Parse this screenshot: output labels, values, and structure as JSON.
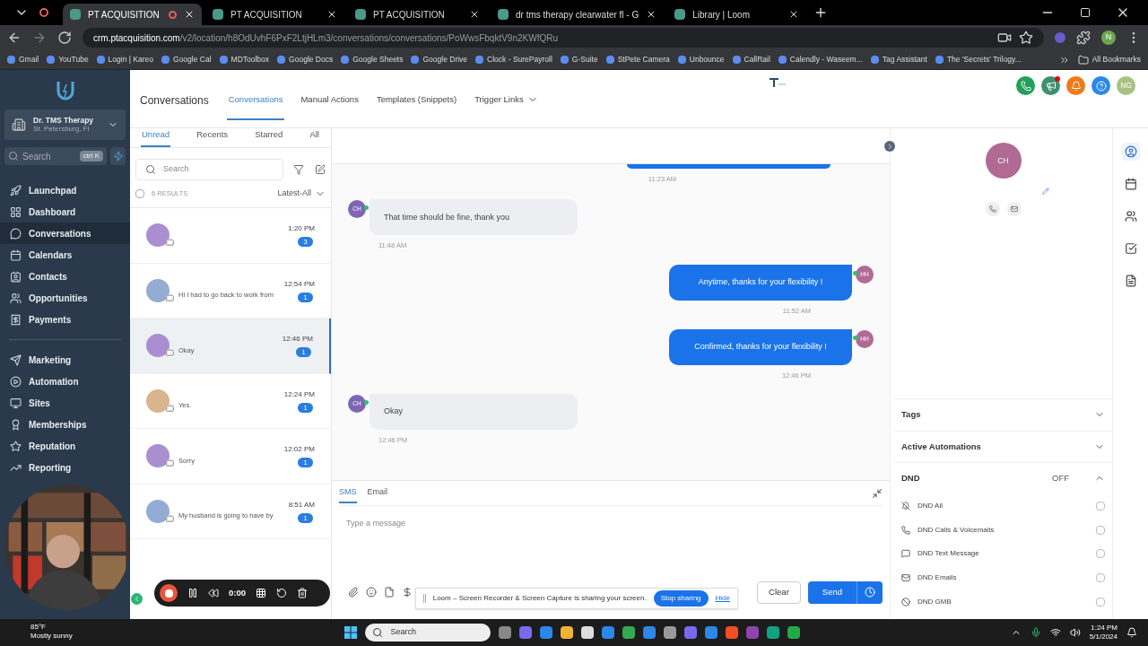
{
  "browser": {
    "tabs": [
      {
        "title": "PT ACQUISITION",
        "selected": true,
        "recording": true
      },
      {
        "title": "PT ACQUISITION",
        "selected": false,
        "recording": false
      },
      {
        "title": "PT ACQUISITION",
        "selected": false,
        "recording": false
      },
      {
        "title": "dr tms therapy clearwater fl - G",
        "selected": false,
        "recording": false
      },
      {
        "title": "Library | Loom",
        "selected": false,
        "recording": false
      }
    ],
    "url_host": "crm.ptacquisition.com",
    "url_path": "/v2/location/h8OdUvhF6PxF2LtjHLm3/conversations/conversations/PoWwsFbqktV9n2KWfQRu",
    "bookmarks": [
      "Gmail",
      "YouTube",
      "Login | Kareo",
      "Google Cal",
      "MDToolbox",
      "Google Docs",
      "Google Sheets",
      "Google Drive",
      "Clock - SurePayroll",
      "G-Suite",
      "StPete Camera",
      "Unbounce",
      "CallRail",
      "Calendly - Waseem...",
      "Tag Assistant",
      "The 'Secrets' Trilogy..."
    ],
    "all_bookmarks": "All Bookmarks",
    "profile": "N"
  },
  "account": {
    "name": "Dr. TMS Therapy",
    "location": "St. Petersburg, Fl"
  },
  "sidebar_search": {
    "placeholder": "Search",
    "shortcut": "ctrl K"
  },
  "nav_groups": [
    [
      {
        "label": "Launchpad",
        "selected": false
      },
      {
        "label": "Dashboard",
        "selected": false
      },
      {
        "label": "Conversations",
        "selected": true
      },
      {
        "label": "Calendars",
        "selected": false
      },
      {
        "label": "Contacts",
        "selected": false
      },
      {
        "label": "Opportunities",
        "selected": false
      },
      {
        "label": "Payments",
        "selected": false
      }
    ],
    [
      {
        "label": "Marketing",
        "selected": false
      },
      {
        "label": "Automation",
        "selected": false
      },
      {
        "label": "Sites",
        "selected": false
      },
      {
        "label": "Memberships",
        "selected": false
      },
      {
        "label": "Reputation",
        "selected": false
      },
      {
        "label": "Reporting",
        "selected": false
      }
    ]
  ],
  "header": {
    "title": "Conversations",
    "tabs": [
      {
        "label": "Conversations",
        "selected": true,
        "dropdown": false
      },
      {
        "label": "Manual Actions",
        "selected": false,
        "dropdown": false
      },
      {
        "label": "Templates (Snippets)",
        "selected": false,
        "dropdown": false
      },
      {
        "label": "Trigger Links",
        "selected": false,
        "dropdown": true
      }
    ],
    "user_initials": "NG"
  },
  "list": {
    "tabs": [
      {
        "label": "Unread",
        "selected": true
      },
      {
        "label": "Recents",
        "selected": false
      },
      {
        "label": "Starred",
        "selected": false
      },
      {
        "label": "All",
        "selected": false
      }
    ],
    "search_placeholder": "Search",
    "select_all_checked": false,
    "results": "6 RESULTS",
    "sort": "Latest-All",
    "conversations": [
      {
        "color": "#a98fd0",
        "time": "1:20 PM",
        "unread": "3",
        "selected": false
      },
      {
        "color": "#93acd3",
        "preview": "Hi I had to go back to work from",
        "time": "12:54 PM",
        "unread": "1",
        "selected": false
      },
      {
        "color": "#a98fd0",
        "preview": "Okay",
        "time": "12:46 PM",
        "unread": "1",
        "selected": true
      },
      {
        "color": "#d8b58e",
        "preview": "Yes.",
        "time": "12:24 PM",
        "unread": "1",
        "selected": false
      },
      {
        "color": "#a98fd0",
        "preview": "Sorry",
        "time": "12:02 PM",
        "unread": "1",
        "selected": false
      },
      {
        "color": "#93acd3",
        "preview": "My husband is going to have by",
        "time": "8:51 AM",
        "unread": "1",
        "selected": false
      }
    ]
  },
  "messages": [
    {
      "kind": "outgoing",
      "time": "11:23 AM"
    },
    {
      "kind": "incoming",
      "initials": "CH",
      "text": "That time should be fine, thank you",
      "time": "11:48 AM"
    },
    {
      "kind": "outgoing",
      "initials": "HH",
      "text": "Anytime, thanks for your flexibility !",
      "time": "11:52 AM"
    },
    {
      "kind": "outgoing",
      "initials": "HH",
      "text": "Confirmed, thanks for your flexibility !",
      "time": "12:46 PM"
    },
    {
      "kind": "incoming",
      "initials": "CH",
      "text": "Okay",
      "time": "12:46 PM"
    }
  ],
  "composer": {
    "tabs": [
      {
        "label": "SMS",
        "selected": true
      },
      {
        "label": "Email",
        "selected": false
      }
    ],
    "placeholder": "Type a message",
    "clear": "Clear",
    "send": "Send"
  },
  "loom": {
    "timer": "0:00",
    "banner": "Loom – Screen Recorder & Screen Capture is sharing your screen.",
    "stop": "Stop sharing",
    "hide": "Hide"
  },
  "contact": {
    "initials": "CH",
    "sections": [
      {
        "label": "Tags",
        "expanded": false
      },
      {
        "label": "Active Automations",
        "expanded": false
      },
      {
        "label": "DND",
        "expanded": true,
        "value": "OFF"
      }
    ],
    "dnd": [
      {
        "kind": "all",
        "label": "DND All",
        "checked": false
      },
      {
        "kind": "calls",
        "label": "DND Calls & Voicemails",
        "checked": false
      },
      {
        "kind": "text",
        "label": "DND Text Message",
        "checked": false
      },
      {
        "kind": "email",
        "label": "DND Emails",
        "checked": false
      },
      {
        "kind": "gmb",
        "label": "DND GMB",
        "checked": false
      }
    ]
  },
  "taskbar": {
    "temperature": "85°F",
    "weather": "Mostly sunny",
    "search": "Search",
    "time": "1:24 PM",
    "date": "5/1/2024"
  }
}
